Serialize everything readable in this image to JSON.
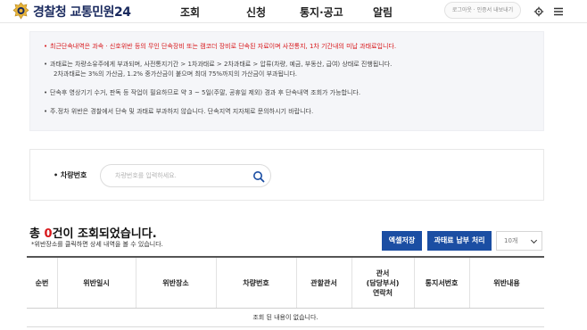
{
  "header": {
    "logo_text": "경찰청 교통민원24",
    "nav": [
      "조회",
      "신청",
      "통지·공고",
      "알림"
    ],
    "login_text": "로그아웃 · 인증서 내보내기"
  },
  "notice": {
    "lines": [
      "최근단속내역은 과속 · 신호위반 등의 무인 단속장비 또는 캠코더 장비로 단속된 자료이며 사전통지, 1차 기간내의 미납 과태료입니다.",
      "과태료는 차량소유주에게 부과되며, 사전통지기간 > 1차과태료 > 2차과태료 > 압류(차량, 예금, 부동산, 급여) 상태로 진행됩니다.",
      "2차과태료는 3%의 가산금, 1.2% 중가산금이 붙으며 최대 75%까지의 가산금이 부과됩니다.",
      "단속후 영상기기 수거, 판독 등 작업이 필요하므로 약 3 ~ 5일(주말, 공휴일 제외) 경과 후 단속내역 조회가 가능합니다.",
      "주.정차 위반은 경찰에서 단속 및 과태료 부과하지 않습니다. 단속지역 지자체로 문의하시기 바랍니다."
    ]
  },
  "search": {
    "label": "차량번호",
    "placeholder": "차량번호를 입력하세요."
  },
  "results": {
    "prefix": "총 ",
    "count": "0",
    "suffix": "건이 조회되었습니다.",
    "hint": "위반장소를 클릭하면 상세 내역을 볼 수 있습니다.",
    "excel_button": "엑셀저장",
    "pay_button": "과태료 납부 처리",
    "page_size": "10개"
  },
  "table": {
    "headers": [
      "순번",
      "위반일시",
      "위반장소",
      "차량번호",
      "관할관서",
      "관서\n(담당부서)\n연락처",
      "통지서번호",
      "위반내용"
    ],
    "empty_text": "조회 된 내용이 없습니다."
  },
  "colors": {
    "accent": "#1b4ea3",
    "alert": "#d8171a",
    "brand": "#1a2a5e"
  }
}
